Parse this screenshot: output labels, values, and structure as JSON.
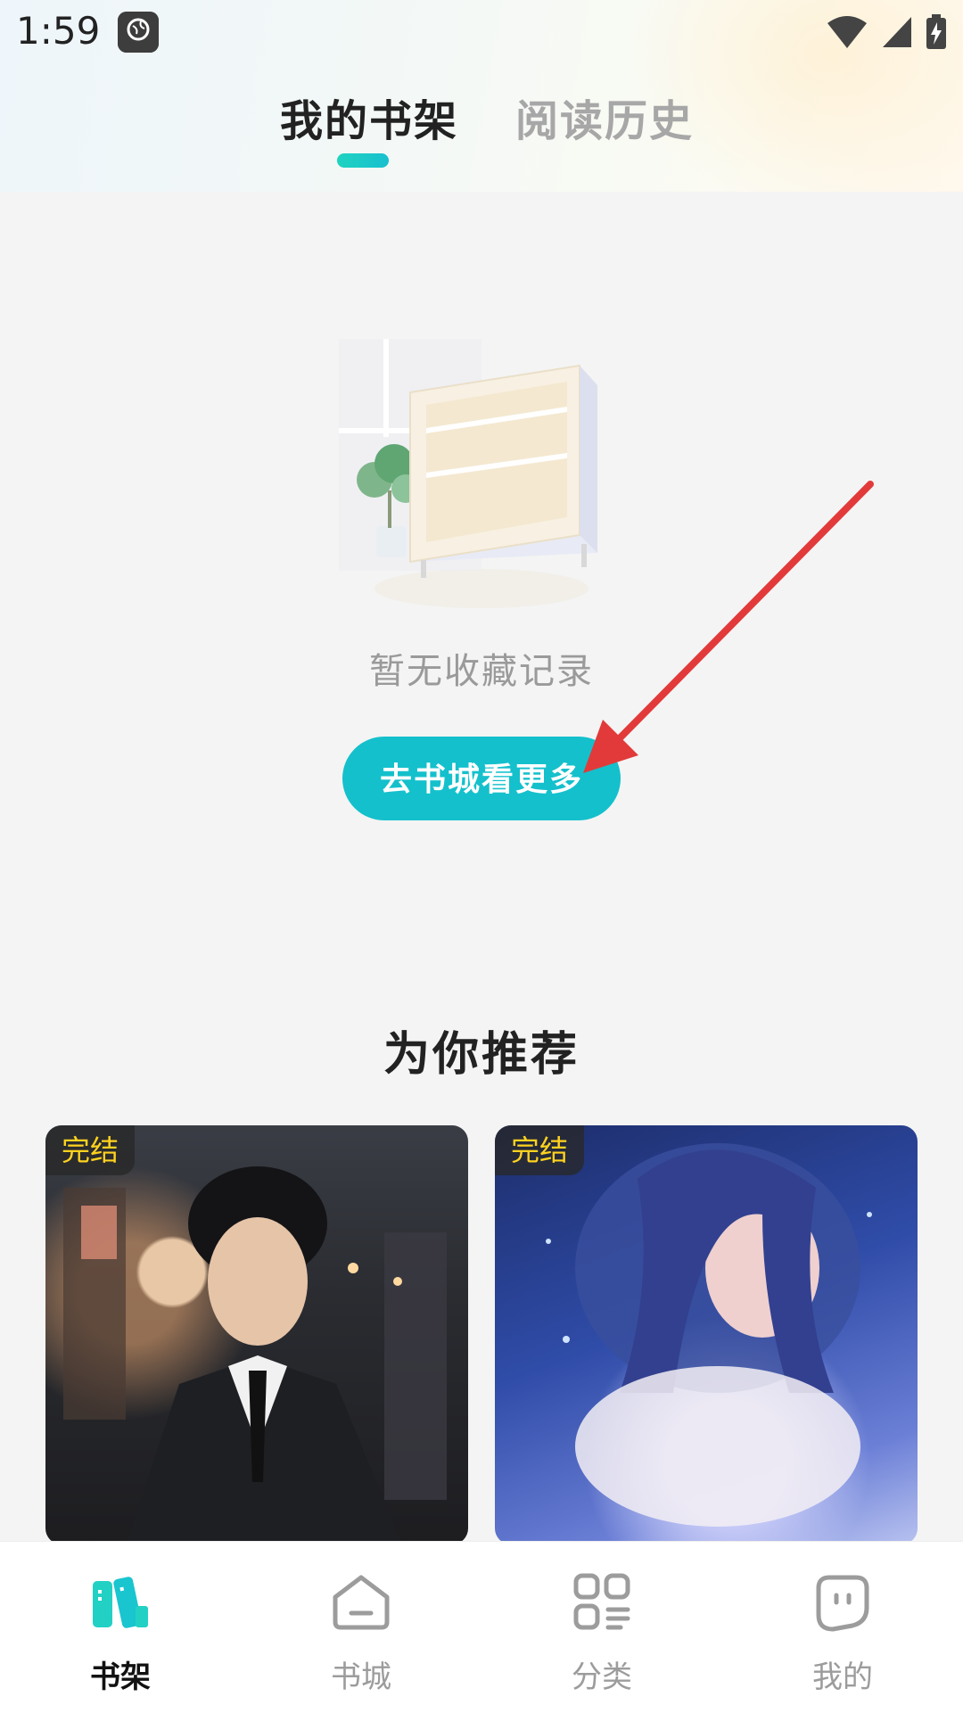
{
  "status_bar": {
    "time": "1:59",
    "app_icon": "globe-app-icon",
    "icons": [
      "wifi-icon",
      "signal-icon",
      "battery-icon"
    ]
  },
  "tabs": [
    {
      "label": "我的书架",
      "active": true
    },
    {
      "label": "阅读历史",
      "active": false
    }
  ],
  "empty_state": {
    "message": "暂无收藏记录",
    "button_label": "去书城看更多",
    "illustration": "empty-bookshelf-illustration"
  },
  "recommend": {
    "title": "为你推荐",
    "books": [
      {
        "badge": "完结",
        "cover": "man-in-suit-city-night-cover"
      },
      {
        "badge": "完结",
        "cover": "girl-in-blue-light-cover"
      }
    ]
  },
  "bottom_nav": [
    {
      "label": "书架",
      "icon": "bookshelf-icon",
      "active": true
    },
    {
      "label": "书城",
      "icon": "bookstore-icon",
      "active": false
    },
    {
      "label": "分类",
      "icon": "category-icon",
      "active": false
    },
    {
      "label": "我的",
      "icon": "profile-icon",
      "active": false
    }
  ],
  "colors": {
    "accent": "#14c0cc",
    "badge_text": "#ffd21f",
    "annotation_arrow": "#e23a3a"
  }
}
